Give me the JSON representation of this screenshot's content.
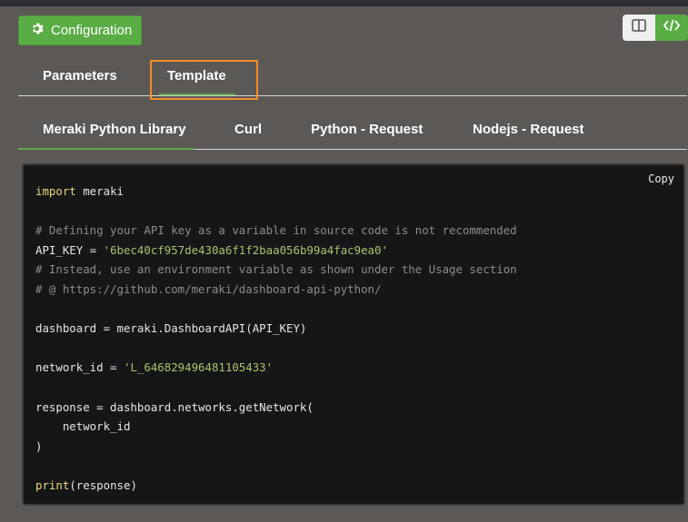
{
  "config_button": {
    "label": "Configuration",
    "icon": "gear-icon",
    "color": "#5aac44"
  },
  "view_toggle": {
    "left_icon": "split-view-icon",
    "right_icon": "code-icon"
  },
  "tabs_primary": [
    {
      "label": "Parameters",
      "active": false
    },
    {
      "label": "Template",
      "active": true
    }
  ],
  "tabs_secondary": [
    {
      "label": "Meraki Python Library",
      "active": true
    },
    {
      "label": "Curl",
      "active": false
    },
    {
      "label": "Python - Request",
      "active": false
    },
    {
      "label": "Nodejs - Request",
      "active": false
    }
  ],
  "code_panel": {
    "copy_label": "Copy",
    "lines": {
      "l1_kw": "import",
      "l1_rest": " meraki",
      "l3": "# Defining your API key as a variable in source code is not recommended",
      "l4_a": "API_KEY = ",
      "l4_str": "'6bec40cf957de430a6f1f2baa056b99a4fac9ea0'",
      "l5": "# Instead, use an environment variable as shown under the Usage section",
      "l6": "# @ https://github.com/meraki/dashboard-api-python/",
      "l8": "dashboard = meraki.DashboardAPI(API_KEY)",
      "l10_a": "network_id = ",
      "l10_str": "'L_646829496481105433'",
      "l12": "response = dashboard.networks.getNetwork(",
      "l13": "    network_id",
      "l14": ")",
      "l16_fn": "print",
      "l16_rest": "(response)"
    }
  }
}
